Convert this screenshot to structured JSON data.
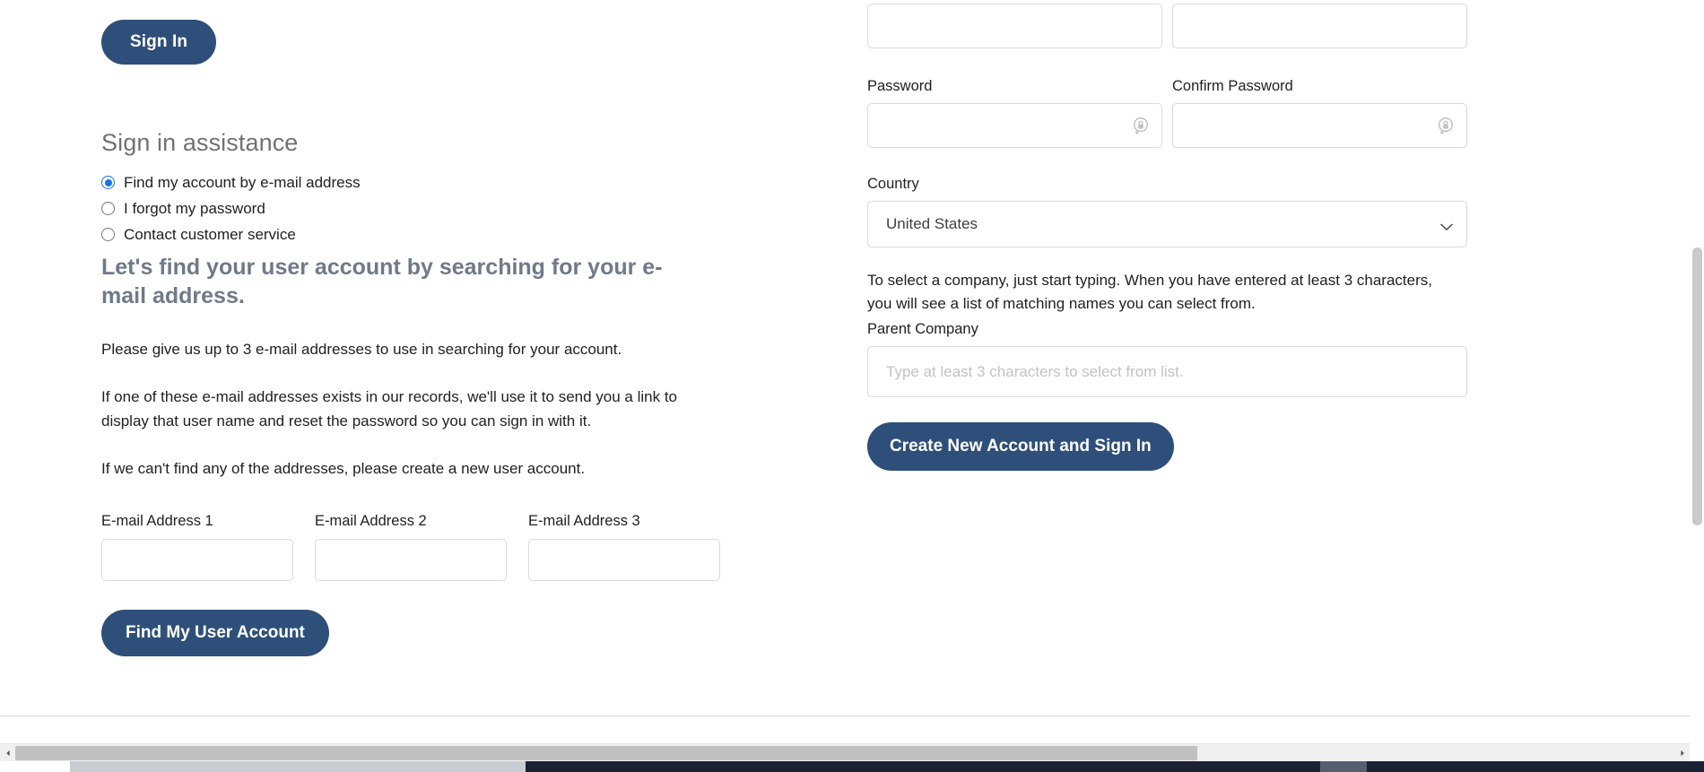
{
  "left": {
    "sign_in_button": "Sign In",
    "assistance_heading": "Sign in assistance",
    "radio_options": [
      {
        "label": "Find my account by e-mail address",
        "selected": true
      },
      {
        "label": "I forgot my password",
        "selected": false
      },
      {
        "label": "Contact customer service",
        "selected": false
      }
    ],
    "section_heading": "Let's find your user account by searching for your e-mail address.",
    "paragraphs": [
      "Please give us up to 3 e-mail addresses to use in searching for your account.",
      "If one of these e-mail addresses exists in our records, we'll use it to send you a link to display that user name and reset the password so you can sign in with it.",
      "If we can't find any of the addresses, please create a new user account."
    ],
    "email_fields": [
      {
        "label": "E-mail Address 1",
        "value": "",
        "placeholder": ""
      },
      {
        "label": "E-mail Address 2",
        "value": "",
        "placeholder": ""
      },
      {
        "label": "E-mail Address 3",
        "value": "",
        "placeholder": ""
      }
    ],
    "find_button": "Find My User Account"
  },
  "right": {
    "name_fields": [
      {
        "value": "",
        "placeholder": ""
      },
      {
        "value": "",
        "placeholder": ""
      }
    ],
    "password_label": "Password",
    "password_value": "",
    "password_placeholder": "",
    "confirm_password_label": "Confirm Password",
    "confirm_password_value": "",
    "confirm_password_placeholder": "",
    "password_icon": "password-reveal-icon",
    "country_label": "Country",
    "country_value": "United States",
    "country_icon": "chevron-down-icon",
    "company_hint": "To select a company, just start typing. When you have entered at least 3 characters, you will see a list of matching names you can select from.",
    "parent_company_label": "Parent Company",
    "parent_company_value": "",
    "parent_company_placeholder": "Type at least 3 characters to select from list.",
    "create_account_button": "Create New Account and Sign In"
  },
  "colors": {
    "brand_navy": "#2e4f79",
    "radio_blue": "#1a73e8",
    "heading_grey": "#6f7276",
    "section_heading_grey": "#6f7a89",
    "body_text": "#202124",
    "input_border": "#d8dade",
    "scroll_thumb": "#c1c1c1",
    "taskbar": "#1b2236"
  },
  "scrollbars": {
    "horizontal_left_arrow": "◄",
    "horizontal_right_arrow": "►"
  }
}
